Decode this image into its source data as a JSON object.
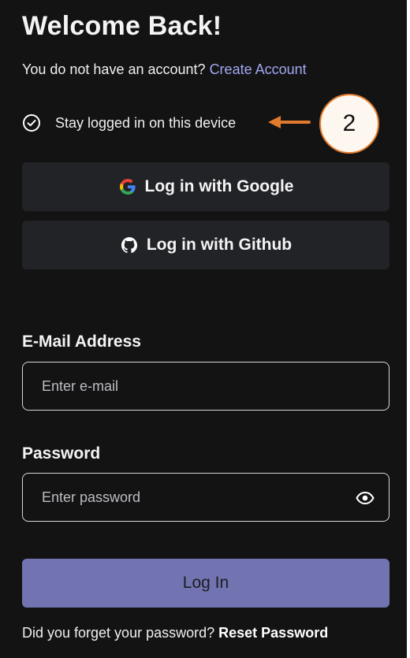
{
  "header": {
    "title": "Welcome Back!",
    "no_account_text": "You do not have an account?",
    "create_account_link": "Create Account"
  },
  "stay_logged_in": {
    "label": "Stay logged in on this device",
    "checked": true
  },
  "annotation": {
    "step_number": "2",
    "accent_color": "#e07a2c"
  },
  "oauth": {
    "google_label": "Log in with Google",
    "github_label": "Log in with Github"
  },
  "email": {
    "label": "E-Mail Address",
    "placeholder": "Enter e-mail",
    "value": ""
  },
  "password": {
    "label": "Password",
    "placeholder": "Enter password",
    "value": ""
  },
  "login_button": {
    "label": "Log In",
    "color": "#7174b0"
  },
  "footer": {
    "forgot_text": "Did you forget your password?",
    "reset_link": "Reset Password"
  },
  "icons": {
    "check": "check-circle-icon",
    "google": "google-icon",
    "github": "github-icon",
    "eye": "eye-icon",
    "arrow": "arrow-left-icon"
  }
}
